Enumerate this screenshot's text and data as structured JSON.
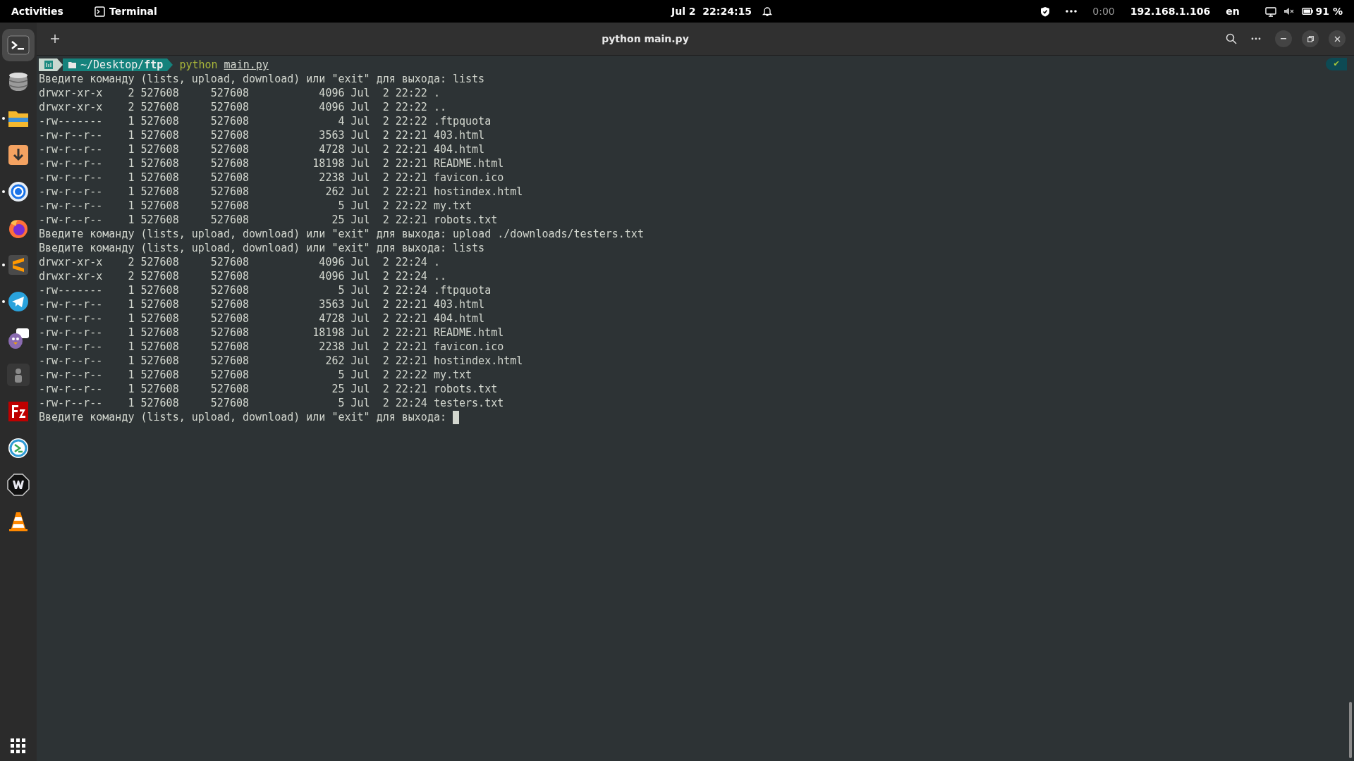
{
  "top_bar": {
    "activities": "Activities",
    "app_name": "Terminal",
    "clock": "Jul 2  22:24:15",
    "timer": "0:00",
    "ip_address": "192.168.1.106",
    "keyboard_layout": "en",
    "battery": "91 %"
  },
  "dock": {
    "items": [
      {
        "kind": "terminal",
        "selected": true,
        "running": false
      },
      {
        "kind": "database",
        "selected": false,
        "running": false
      },
      {
        "kind": "folder",
        "selected": false,
        "running": true
      },
      {
        "kind": "download",
        "selected": false,
        "running": false
      },
      {
        "kind": "chrome",
        "selected": false,
        "running": true
      },
      {
        "kind": "firefox",
        "selected": false,
        "running": false
      },
      {
        "kind": "sublime",
        "selected": false,
        "running": true
      },
      {
        "kind": "telegram",
        "selected": false,
        "running": true
      },
      {
        "kind": "pidgin",
        "selected": false,
        "running": false
      },
      {
        "kind": "user",
        "selected": false,
        "running": false
      },
      {
        "kind": "filezilla",
        "selected": false,
        "running": false
      },
      {
        "kind": "remote",
        "selected": false,
        "running": false
      },
      {
        "kind": "vpn",
        "selected": false,
        "running": false
      },
      {
        "kind": "cone",
        "selected": false,
        "running": false
      }
    ]
  },
  "terminal": {
    "title": "python main.py",
    "prompt": {
      "path": "~/Desktop/**ftp**",
      "command": "python",
      "argument": "main.py",
      "status": "✔"
    },
    "lines": [
      "Введите команду (lists, upload, download) или \"exit\" для выхода: lists",
      "drwxr-xr-x    2 527608     527608           4096 Jul  2 22:22 .",
      "drwxr-xr-x    2 527608     527608           4096 Jul  2 22:22 ..",
      "-rw-------    1 527608     527608              4 Jul  2 22:22 .ftpquota",
      "-rw-r--r--    1 527608     527608           3563 Jul  2 22:21 403.html",
      "-rw-r--r--    1 527608     527608           4728 Jul  2 22:21 404.html",
      "-rw-r--r--    1 527608     527608          18198 Jul  2 22:21 README.html",
      "-rw-r--r--    1 527608     527608           2238 Jul  2 22:21 favicon.ico",
      "-rw-r--r--    1 527608     527608            262 Jul  2 22:21 hostindex.html",
      "-rw-r--r--    1 527608     527608              5 Jul  2 22:22 my.txt",
      "-rw-r--r--    1 527608     527608             25 Jul  2 22:21 robots.txt",
      "Введите команду (lists, upload, download) или \"exit\" для выхода: upload ./downloads/testers.txt",
      "Введите команду (lists, upload, download) или \"exit\" для выхода: lists",
      "drwxr-xr-x    2 527608     527608           4096 Jul  2 22:24 .",
      "drwxr-xr-x    2 527608     527608           4096 Jul  2 22:24 ..",
      "-rw-------    1 527608     527608              5 Jul  2 22:24 .ftpquota",
      "-rw-r--r--    1 527608     527608           3563 Jul  2 22:21 403.html",
      "-rw-r--r--    1 527608     527608           4728 Jul  2 22:21 404.html",
      "-rw-r--r--    1 527608     527608          18198 Jul  2 22:21 README.html",
      "-rw-r--r--    1 527608     527608           2238 Jul  2 22:21 favicon.ico",
      "-rw-r--r--    1 527608     527608            262 Jul  2 22:21 hostindex.html",
      "-rw-r--r--    1 527608     527608              5 Jul  2 22:22 my.txt",
      "-rw-r--r--    1 527608     527608             25 Jul  2 22:21 robots.txt",
      "-rw-r--r--    1 527608     527608              5 Jul  2 22:24 testers.txt",
      "Введите команду (lists, upload, download) или \"exit\" для выхода: "
    ],
    "cursor": true
  }
}
